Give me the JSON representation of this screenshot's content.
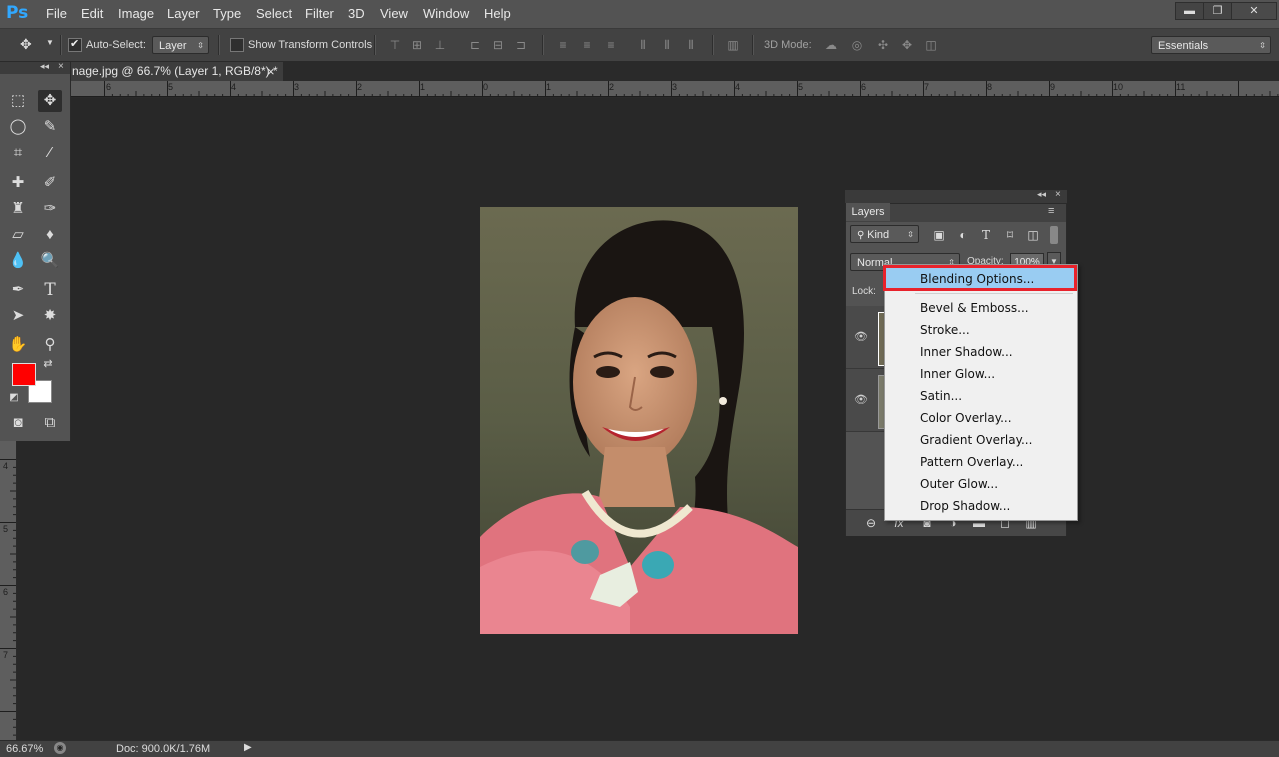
{
  "app": {
    "logo": "Ps"
  },
  "menu": [
    "File",
    "Edit",
    "Image",
    "Layer",
    "Type",
    "Select",
    "Filter",
    "3D",
    "View",
    "Window",
    "Help"
  ],
  "window_buttons": {
    "minimize": "▬",
    "restore": "❐",
    "close": "✕"
  },
  "options": {
    "tool_icon": "move-tool-icon",
    "auto_select_label": "Auto-Select:",
    "auto_select_checked": true,
    "auto_select_value": "Layer",
    "transform_label": "Show Transform Controls",
    "mode_label": "3D Mode:",
    "workspace": "Essentials"
  },
  "document_tab": {
    "title": "nage.jpg @ 66.7% (Layer 1, RGB/8*) *",
    "close": "×"
  },
  "ruler_top": [
    "6",
    "5",
    "4",
    "3",
    "2",
    "1",
    "0",
    "1",
    "2",
    "3",
    "4",
    "5",
    "6",
    "7",
    "8",
    "9",
    "10",
    "11"
  ],
  "ruler_left": [
    "4",
    "5",
    "6",
    "7"
  ],
  "colors": {
    "foreground": "#ff0000",
    "background": "#ffffff",
    "menu_highlight": "#99ccf2",
    "callout_border": "#e8222b"
  },
  "layers_panel": {
    "tab": "Layers",
    "filter_kind": "Kind",
    "blend_mode": "Normal",
    "opacity_label": "Opacity:",
    "opacity_value": "100%",
    "lock_label": "Lock:"
  },
  "context_menu": {
    "items": [
      "Blending Options...",
      "Bevel & Emboss...",
      "Stroke...",
      "Inner Shadow...",
      "Inner Glow...",
      "Satin...",
      "Color Overlay...",
      "Gradient Overlay...",
      "Pattern Overlay...",
      "Outer Glow...",
      "Drop Shadow..."
    ],
    "highlighted_index": 0
  },
  "status": {
    "zoom": "66.67%",
    "doc_info": "Doc: 900.0K/1.76M"
  }
}
